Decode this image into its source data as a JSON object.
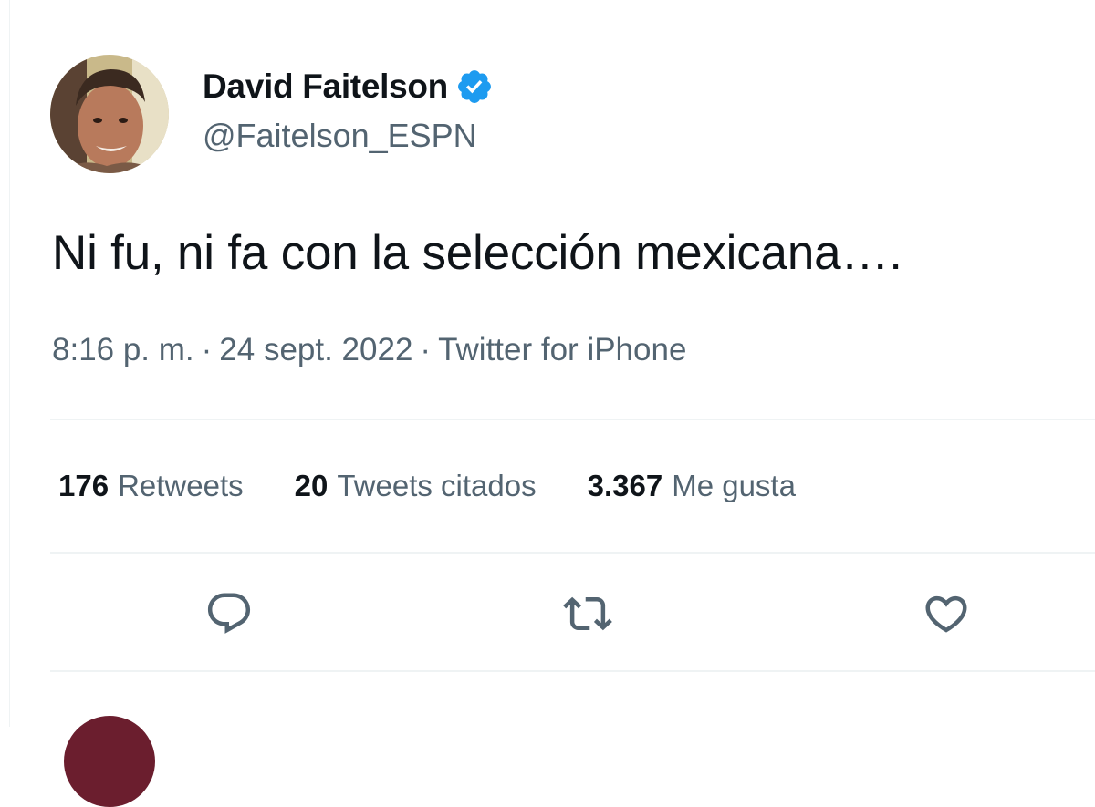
{
  "tweet": {
    "author": {
      "display_name": "David Faitelson",
      "handle": "@Faitelson_ESPN",
      "verified_icon": "verified-badge-icon",
      "verified_color": "#1d9bf0"
    },
    "text": "Ni fu, ni fa con la selección mexicana….",
    "meta": {
      "time": "8:16 p. m.",
      "date": "24 sept. 2022",
      "source": "Twitter for iPhone",
      "separator": "·"
    },
    "stats": [
      {
        "count": "176",
        "label": "Retweets"
      },
      {
        "count": "20",
        "label": "Tweets citados"
      },
      {
        "count": "3.367",
        "label": "Me gusta"
      }
    ],
    "actions": [
      {
        "icon": "reply-icon"
      },
      {
        "icon": "retweet-icon"
      },
      {
        "icon": "like-icon"
      }
    ]
  },
  "colors": {
    "text_primary": "#0f1419",
    "text_secondary": "#536471",
    "divider": "#eff3f4",
    "icon": "#536471"
  }
}
